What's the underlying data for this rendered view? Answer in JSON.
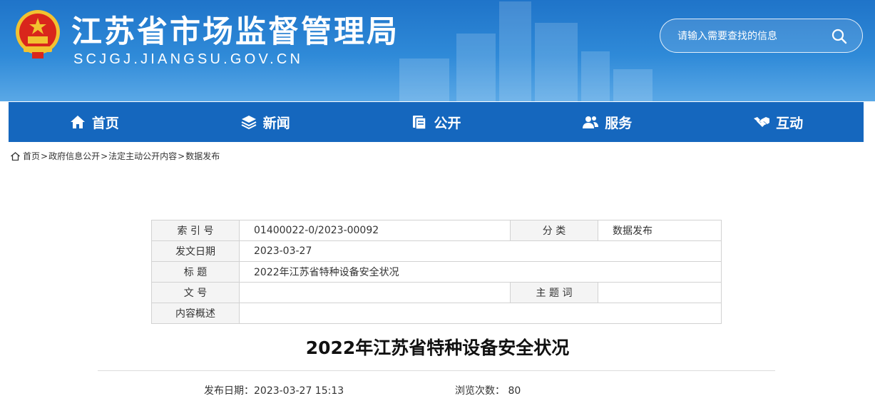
{
  "site": {
    "title_cn": "江苏省市场监督管理局",
    "title_en": "SCJGJ.JIANGSU.GOV.CN"
  },
  "search": {
    "placeholder": "请输入需要查找的信息"
  },
  "nav": [
    {
      "label": "首页",
      "icon": "home-icon"
    },
    {
      "label": "新闻",
      "icon": "layers-icon"
    },
    {
      "label": "公开",
      "icon": "documents-icon"
    },
    {
      "label": "服务",
      "icon": "users-icon"
    },
    {
      "label": "互动",
      "icon": "handshake-icon"
    }
  ],
  "breadcrumb": [
    "首页",
    "政府信息公开",
    "法定主动公开内容",
    "数据发布"
  ],
  "meta": {
    "index_label": "索 引 号",
    "index_value": "01400022-0/2023-00092",
    "category_label": "分 类",
    "category_value": "数据发布",
    "date_label": "发文日期",
    "date_value": "2023-03-27",
    "title_label": "标 题",
    "title_value": "2022年江苏省特种设备安全状况",
    "docno_label": "文 号",
    "docno_value": "",
    "keywords_label": "主 题 词",
    "keywords_value": "",
    "summary_label": "内容概述",
    "summary_value": ""
  },
  "article": {
    "title": "2022年江苏省特种设备安全状况",
    "publish_label": "发布日期：",
    "publish_value": "2023-03-27 15:13",
    "views_label": "浏览次数：",
    "views_value": "80"
  },
  "colors": {
    "header_blue": "#2f8ad8",
    "nav_blue": "#1567be"
  }
}
